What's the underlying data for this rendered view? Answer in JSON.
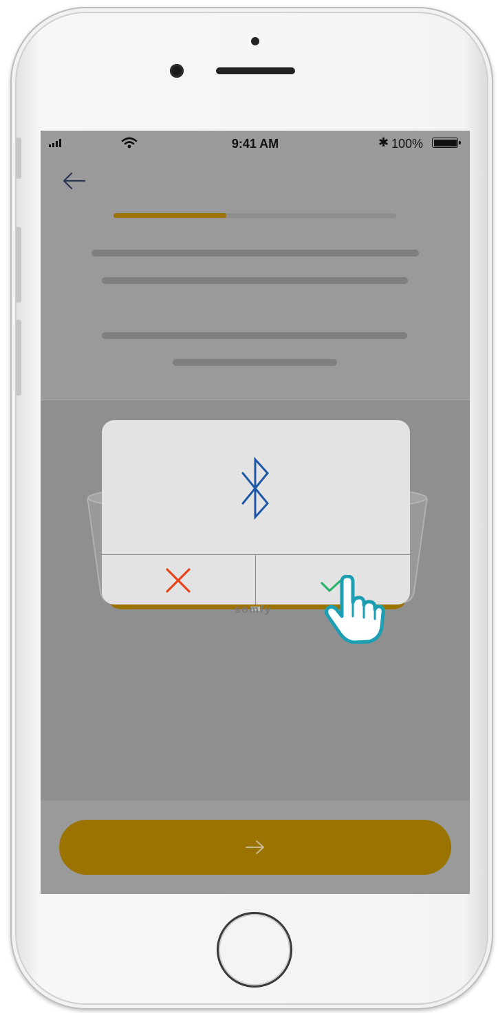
{
  "status_bar": {
    "time": "9:41 AM",
    "battery": "100%"
  },
  "progress": {
    "fraction": 0.4
  },
  "device": {
    "brand": "somfy"
  },
  "dialog": {
    "icon": "bluetooth-icon",
    "cancel_icon": "close-icon",
    "confirm_icon": "check-icon"
  },
  "footer": {
    "next_icon": "arrow-right-icon"
  },
  "colors": {
    "accent": "#9b7300",
    "bluetooth": "#1f57a8",
    "cancel": "#e8441a",
    "confirm": "#27b26a",
    "pointer": "#1d9fb3"
  }
}
